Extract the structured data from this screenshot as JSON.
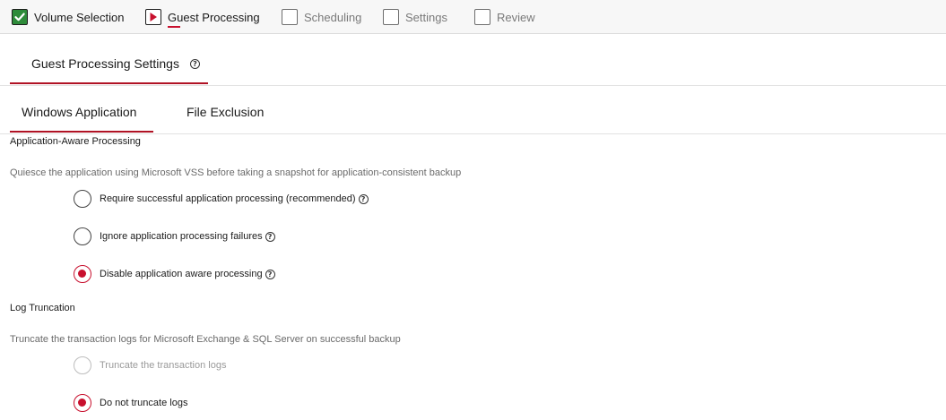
{
  "stepper": {
    "steps": [
      {
        "label": "Volume Selection",
        "state": "completed",
        "icon": "checkbox-checked-icon"
      },
      {
        "label": "Guest Processing",
        "state": "current",
        "icon": "play-icon"
      },
      {
        "label": "Scheduling",
        "state": "pending",
        "icon": "checkbox-empty-icon"
      },
      {
        "label": "Settings",
        "state": "pending",
        "icon": "checkbox-empty-icon"
      },
      {
        "label": "Review",
        "state": "pending",
        "icon": "checkbox-empty-icon"
      }
    ]
  },
  "section": {
    "title": "Guest Processing Settings",
    "help_icon": "help-icon",
    "help_glyph": "?"
  },
  "tabs": [
    {
      "label": "Windows Application",
      "active": true
    },
    {
      "label": "File Exclusion",
      "active": false
    }
  ],
  "app_aware": {
    "heading": "Application-Aware Processing",
    "description": "Quiesce the application using Microsoft VSS before taking a snapshot for application-consistent backup",
    "options": [
      {
        "label": "Require successful application processing (recommended)",
        "checked": false,
        "disabled": false,
        "help": true
      },
      {
        "label": "Ignore application processing failures",
        "checked": false,
        "disabled": false,
        "help": true
      },
      {
        "label": "Disable application aware processing",
        "checked": true,
        "disabled": false,
        "help": true
      }
    ]
  },
  "log_truncation": {
    "heading": "Log Truncation",
    "description": "Truncate the transaction logs for Microsoft Exchange & SQL Server on successful backup",
    "options": [
      {
        "label": "Truncate the transaction logs",
        "checked": false,
        "disabled": true,
        "help": false
      },
      {
        "label": "Do not truncate logs",
        "checked": true,
        "disabled": false,
        "help": false
      }
    ]
  },
  "colors": {
    "accent": "#c8102e",
    "completed": "#2e8b3a",
    "muted_text": "#6a6a6a"
  }
}
